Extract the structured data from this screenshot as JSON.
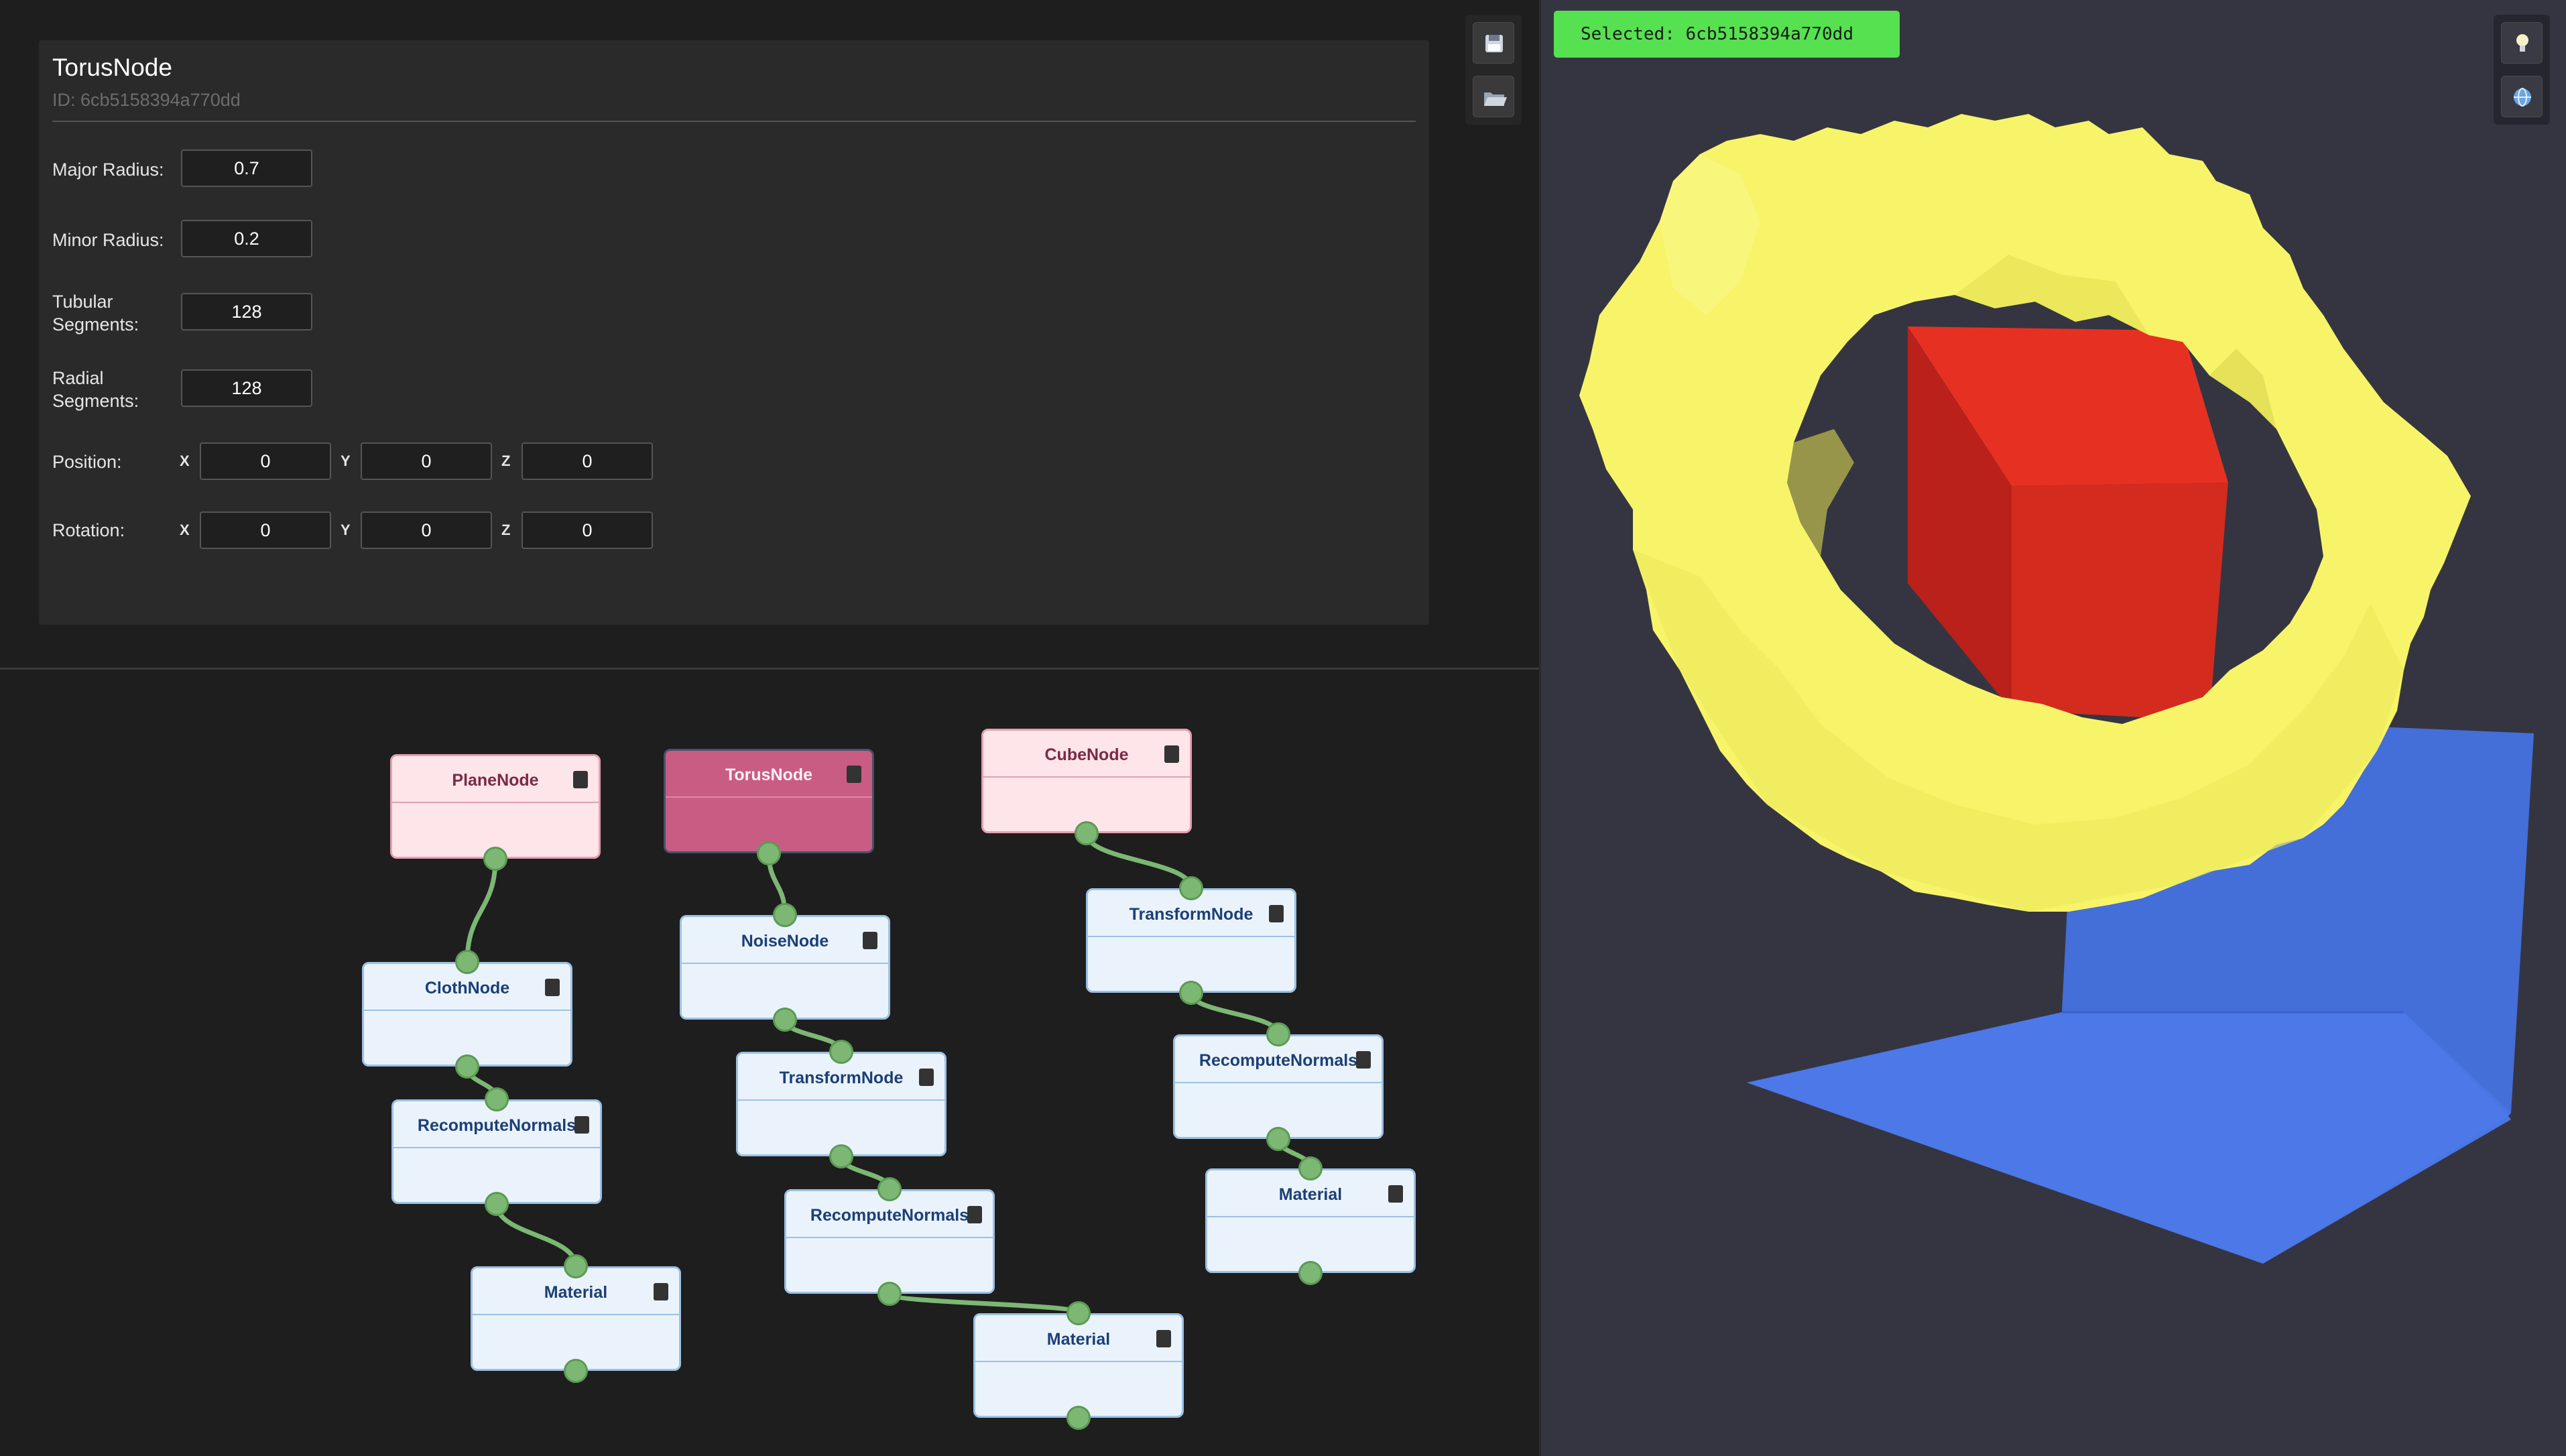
{
  "properties": {
    "node_title": "TorusNode",
    "node_id": "ID: 6cb5158394a770dd",
    "major_radius": {
      "label": "Major Radius:",
      "value": "0.7"
    },
    "minor_radius": {
      "label": "Minor Radius:",
      "value": "0.2"
    },
    "tubular_segments": {
      "label": "Tubular Segments:",
      "value": "128"
    },
    "radial_segments": {
      "label": "Radial Segments:",
      "value": "128"
    },
    "position": {
      "label": "Position:",
      "x": "0",
      "y": "0",
      "z": "0"
    },
    "rotation": {
      "label": "Rotation:",
      "x": "0",
      "y": "0",
      "z": "0"
    },
    "axis_labels": {
      "x": "X",
      "y": "Y",
      "z": "Z"
    }
  },
  "toolbar": {
    "icons": [
      "save-icon",
      "folder-open-icon"
    ]
  },
  "viewport": {
    "selected_text": "Selected: 6cb5158394a770dd",
    "tool_icons": [
      "lightbulb-icon",
      "globe-icon"
    ],
    "colors": {
      "torus": "#f7f46a",
      "cube": "#dc2e20",
      "plane": "#4a75e4",
      "background": "#353541",
      "badge": "#56e150"
    }
  },
  "graph": {
    "nodes": [
      {
        "id": "plane",
        "title": "PlaneNode",
        "style": "pink"
      },
      {
        "id": "cloth",
        "title": "ClothNode",
        "style": "blue"
      },
      {
        "id": "rn1",
        "title": "RecomputeNormals",
        "style": "blue"
      },
      {
        "id": "mat1",
        "title": "Material",
        "style": "blue"
      },
      {
        "id": "torus",
        "title": "TorusNode",
        "style": "selected"
      },
      {
        "id": "noise",
        "title": "NoiseNode",
        "style": "blue"
      },
      {
        "id": "tr1",
        "title": "TransformNode",
        "style": "blue"
      },
      {
        "id": "rn2",
        "title": "RecomputeNormals",
        "style": "blue"
      },
      {
        "id": "mat2",
        "title": "Material",
        "style": "blue"
      },
      {
        "id": "cube",
        "title": "CubeNode",
        "style": "pink"
      },
      {
        "id": "tr2",
        "title": "TransformNode",
        "style": "blue"
      },
      {
        "id": "rn3",
        "title": "RecomputeNormals",
        "style": "blue"
      },
      {
        "id": "mat3",
        "title": "Material",
        "style": "blue"
      }
    ],
    "edges": [
      [
        "plane",
        "cloth"
      ],
      [
        "cloth",
        "rn1"
      ],
      [
        "rn1",
        "mat1"
      ],
      [
        "torus",
        "noise"
      ],
      [
        "noise",
        "tr1"
      ],
      [
        "tr1",
        "rn2"
      ],
      [
        "rn2",
        "mat2"
      ],
      [
        "cube",
        "tr2"
      ],
      [
        "tr2",
        "rn3"
      ],
      [
        "rn3",
        "mat3"
      ]
    ],
    "colors": {
      "wire": "#7cb874",
      "node_blue": "#eaf3fc",
      "node_pink": "#fde5ea",
      "node_selected": "#c95c82"
    }
  }
}
